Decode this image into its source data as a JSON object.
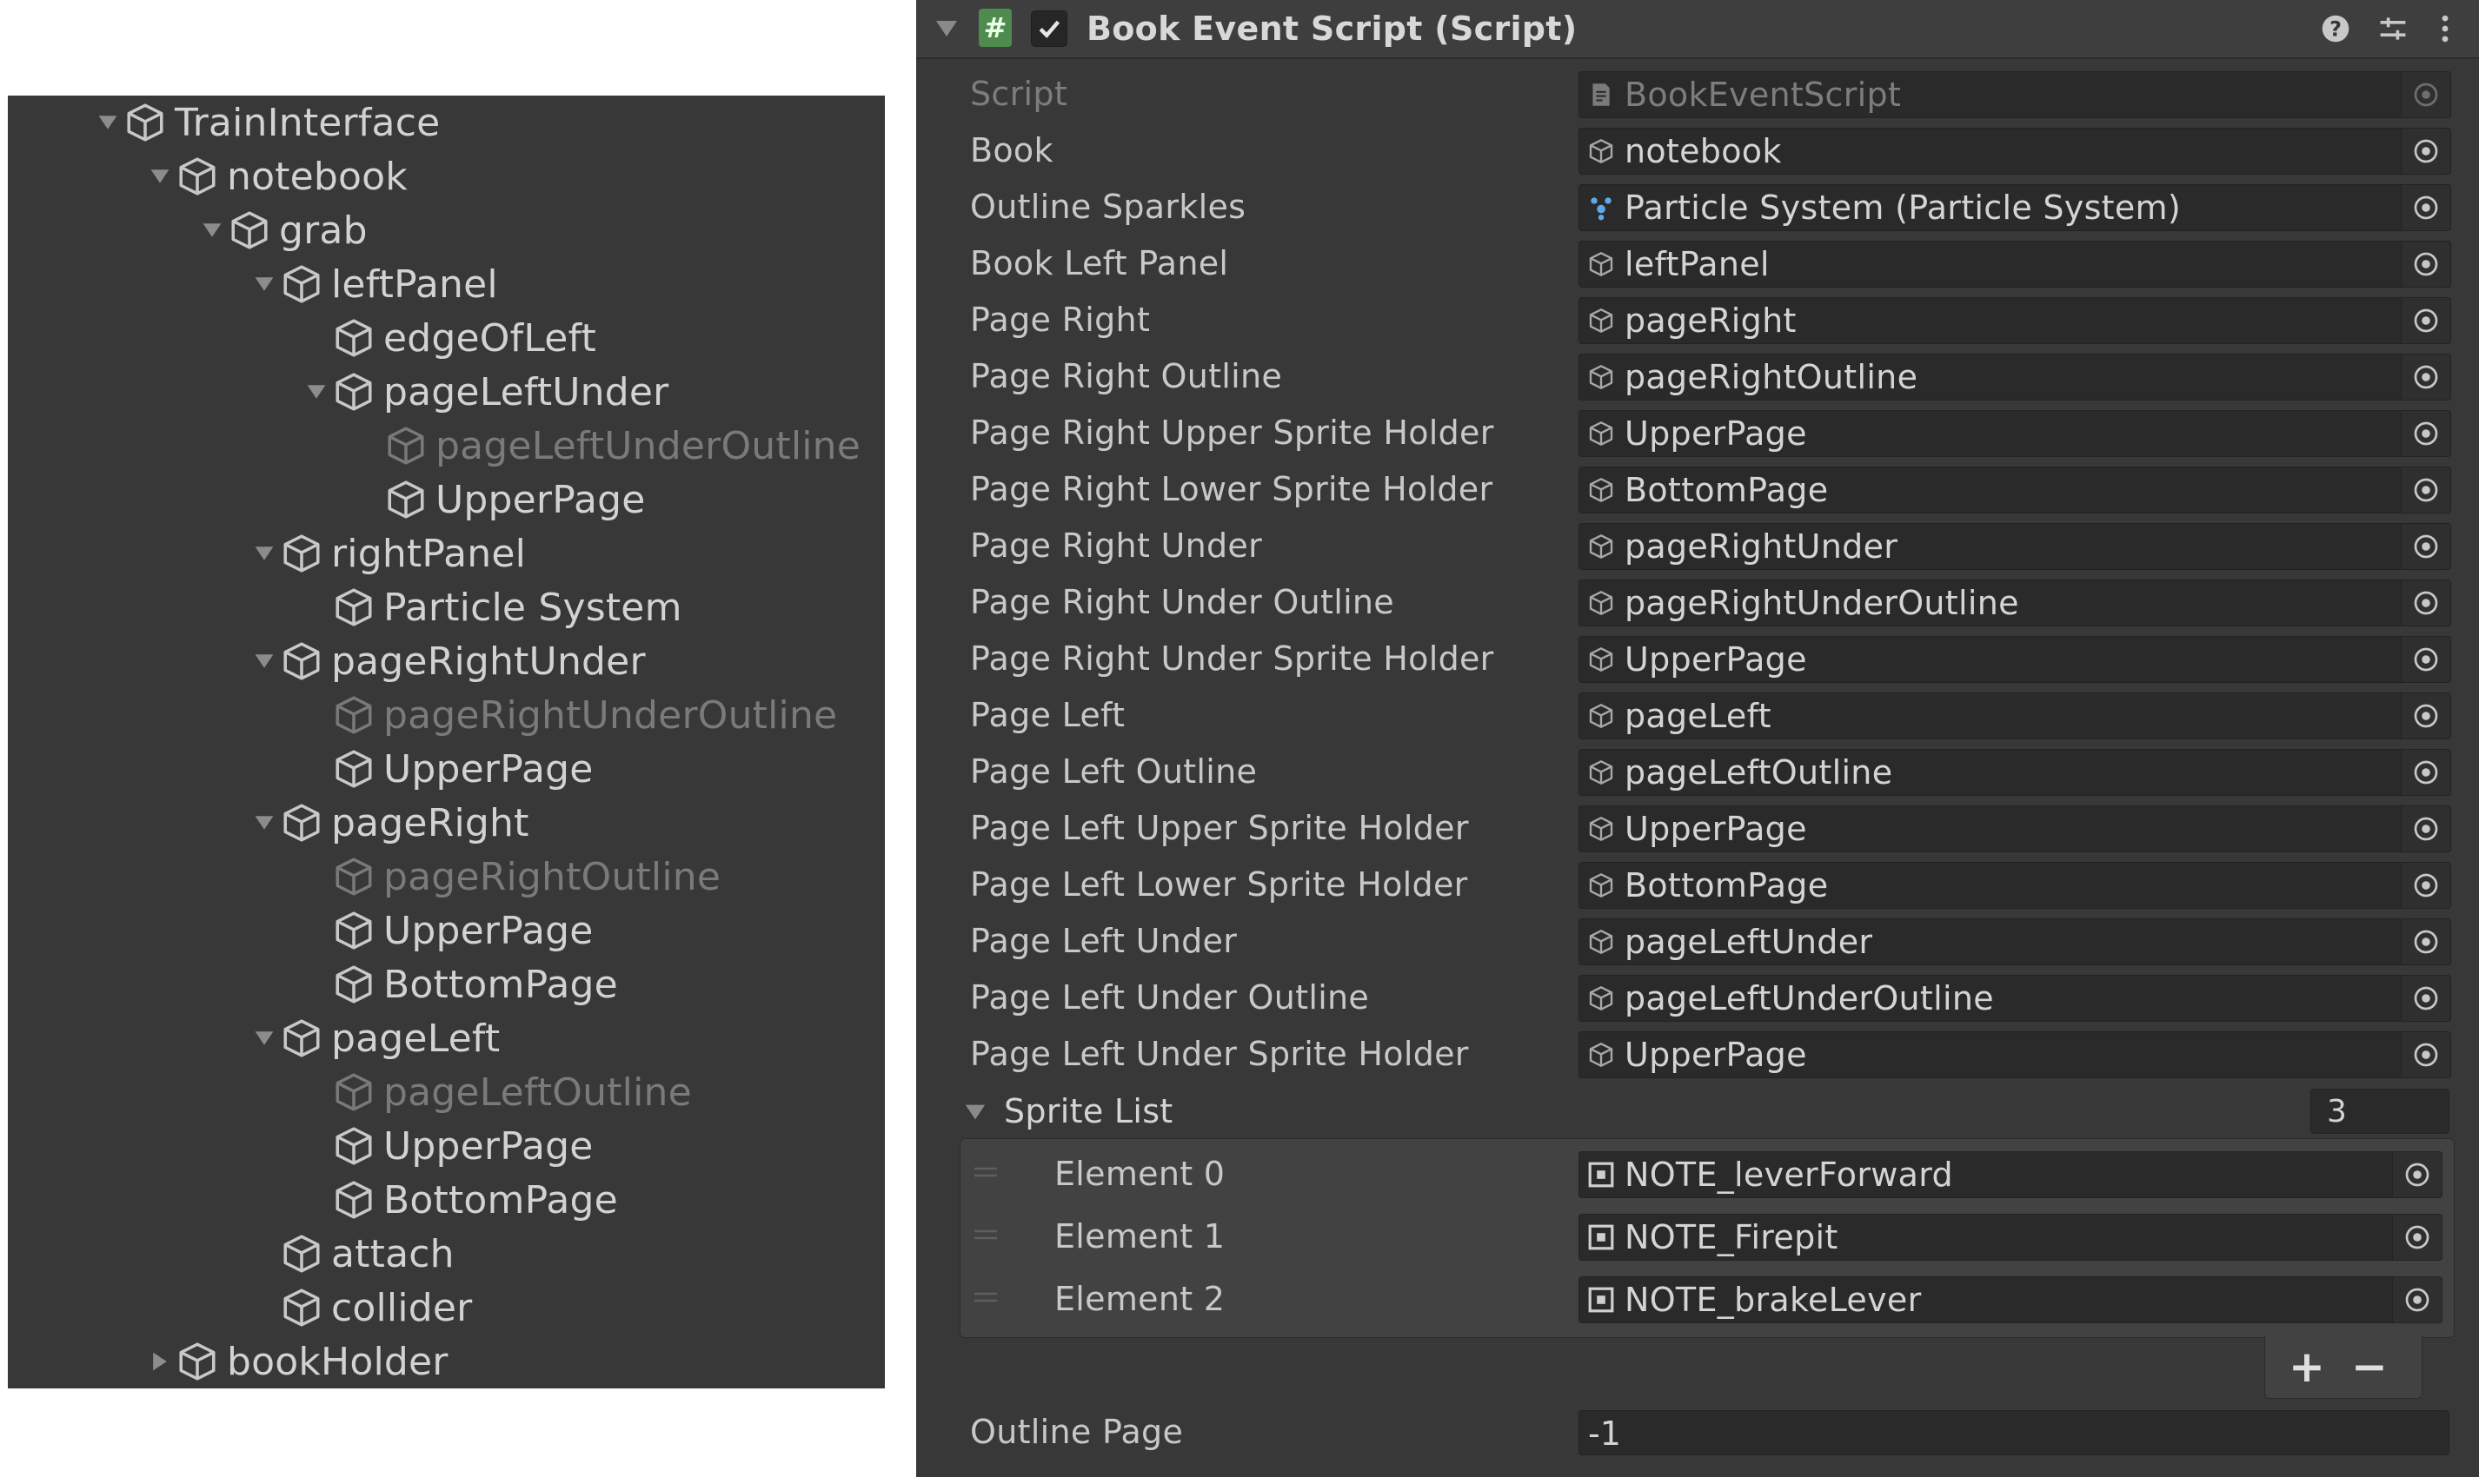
{
  "hierarchy": {
    "items": [
      {
        "label": "TrainInterface",
        "state": "expanded",
        "active": true
      },
      {
        "label": "notebook",
        "state": "expanded",
        "active": true
      },
      {
        "label": "grab",
        "state": "expanded",
        "active": true
      },
      {
        "label": "leftPanel",
        "state": "expanded",
        "active": true
      },
      {
        "label": "edgeOfLeft",
        "state": "leaf",
        "active": true
      },
      {
        "label": "pageLeftUnder",
        "state": "expanded",
        "active": true
      },
      {
        "label": "pageLeftUnderOutline",
        "state": "leaf",
        "active": false
      },
      {
        "label": "UpperPage",
        "state": "leaf",
        "active": true
      },
      {
        "label": "rightPanel",
        "state": "expanded",
        "active": true
      },
      {
        "label": "Particle System",
        "state": "leaf",
        "active": true
      },
      {
        "label": "pageRightUnder",
        "state": "expanded",
        "active": true
      },
      {
        "label": "pageRightUnderOutline",
        "state": "leaf",
        "active": false
      },
      {
        "label": "UpperPage",
        "state": "leaf",
        "active": true
      },
      {
        "label": "pageRight",
        "state": "expanded",
        "active": true
      },
      {
        "label": "pageRightOutline",
        "state": "leaf",
        "active": false
      },
      {
        "label": "UpperPage",
        "state": "leaf",
        "active": true
      },
      {
        "label": "BottomPage",
        "state": "leaf",
        "active": true
      },
      {
        "label": "pageLeft",
        "state": "expanded",
        "active": true
      },
      {
        "label": "pageLeftOutline",
        "state": "leaf",
        "active": false
      },
      {
        "label": "UpperPage",
        "state": "leaf",
        "active": true
      },
      {
        "label": "BottomPage",
        "state": "leaf",
        "active": true
      },
      {
        "label": "attach",
        "state": "leaf",
        "active": true
      },
      {
        "label": "collider",
        "state": "leaf",
        "active": true
      },
      {
        "label": "bookHolder",
        "state": "collapsed",
        "active": true
      }
    ]
  },
  "inspector": {
    "component_title": "Book Event Script (Script)",
    "enabled": true,
    "script_icon_glyph": "#",
    "header_buttons": [
      "help-icon",
      "preset-icon",
      "more-icon"
    ],
    "properties": [
      {
        "label": "Script",
        "value": "BookEventScript",
        "icon": "script-icon",
        "disabled": true
      },
      {
        "label": "Book",
        "value": "notebook",
        "icon": "gameobject-icon"
      },
      {
        "label": "Outline Sparkles",
        "value": "Particle System (Particle System)",
        "icon": "particle-system-icon"
      },
      {
        "label": "Book Left Panel",
        "value": "leftPanel",
        "icon": "gameobject-icon"
      },
      {
        "label": "Page Right",
        "value": "pageRight",
        "icon": "gameobject-icon"
      },
      {
        "label": "Page Right Outline",
        "value": "pageRightOutline",
        "icon": "gameobject-icon"
      },
      {
        "label": "Page Right Upper Sprite Holder",
        "value": "UpperPage",
        "icon": "gameobject-icon"
      },
      {
        "label": "Page Right Lower Sprite Holder",
        "value": "BottomPage",
        "icon": "gameobject-icon"
      },
      {
        "label": "Page Right Under",
        "value": "pageRightUnder",
        "icon": "gameobject-icon"
      },
      {
        "label": "Page Right Under Outline",
        "value": "pageRightUnderOutline",
        "icon": "gameobject-icon"
      },
      {
        "label": "Page Right Under Sprite Holder",
        "value": "UpperPage",
        "icon": "gameobject-icon"
      },
      {
        "label": "Page Left",
        "value": "pageLeft",
        "icon": "gameobject-icon"
      },
      {
        "label": "Page Left Outline",
        "value": "pageLeftOutline",
        "icon": "gameobject-icon"
      },
      {
        "label": "Page Left Upper Sprite Holder",
        "value": "UpperPage",
        "icon": "gameobject-icon"
      },
      {
        "label": "Page Left Lower Sprite Holder",
        "value": "BottomPage",
        "icon": "gameobject-icon"
      },
      {
        "label": "Page Left Under",
        "value": "pageLeftUnder",
        "icon": "gameobject-icon"
      },
      {
        "label": "Page Left Under Outline",
        "value": "pageLeftUnderOutline",
        "icon": "gameobject-icon"
      },
      {
        "label": "Page Left Under Sprite Holder",
        "value": "UpperPage",
        "icon": "gameobject-icon"
      }
    ],
    "sprite_list": {
      "label": "Sprite List",
      "size": "3",
      "elements": [
        {
          "label": "Element 0",
          "value": "NOTE_leverForward",
          "icon": "sprite-icon"
        },
        {
          "label": "Element 1",
          "value": "NOTE_Firepit",
          "icon": "sprite-icon"
        },
        {
          "label": "Element 2",
          "value": "NOTE_brakeLever",
          "icon": "sprite-icon"
        }
      ],
      "add_label": "+",
      "remove_label": "−"
    },
    "outline_page": {
      "label": "Outline Page",
      "value": "-1"
    }
  }
}
